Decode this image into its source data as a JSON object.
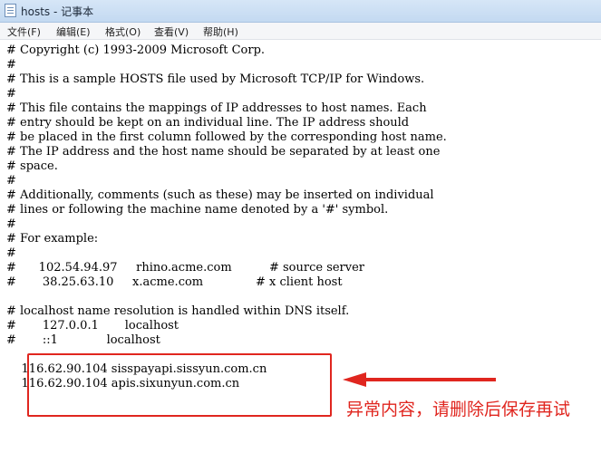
{
  "window": {
    "title": "hosts - 记事本"
  },
  "menu": [
    "文件(F)",
    "编辑(E)",
    "格式(O)",
    "查看(V)",
    "帮助(H)"
  ],
  "lines": [
    "# Copyright (c) 1993-2009 Microsoft Corp.",
    "#",
    "# This is a sample HOSTS file used by Microsoft TCP/IP for Windows.",
    "#",
    "# This file contains the mappings of IP addresses to host names. Each",
    "# entry should be kept on an individual line. The IP address should",
    "# be placed in the first column followed by the corresponding host name.",
    "# The IP address and the host name should be separated by at least one",
    "# space.",
    "#",
    "# Additionally, comments (such as these) may be inserted on individual",
    "# lines or following the machine name denoted by a '#' symbol.",
    "#",
    "# For example:",
    "#",
    "#      102.54.94.97     rhino.acme.com          # source server",
    "#       38.25.63.10     x.acme.com              # x client host",
    "",
    "# localhost name resolution is handled within DNS itself.",
    "#       127.0.0.1       localhost",
    "#       ::1             localhost",
    "",
    "    116.62.90.104 sisspayapi.sissyun.com.cn",
    "    116.62.90.104 apis.sixunyun.com.cn"
  ],
  "annotation": {
    "note": "异常内容，请删除后保存再试",
    "color": "#e0261f"
  }
}
